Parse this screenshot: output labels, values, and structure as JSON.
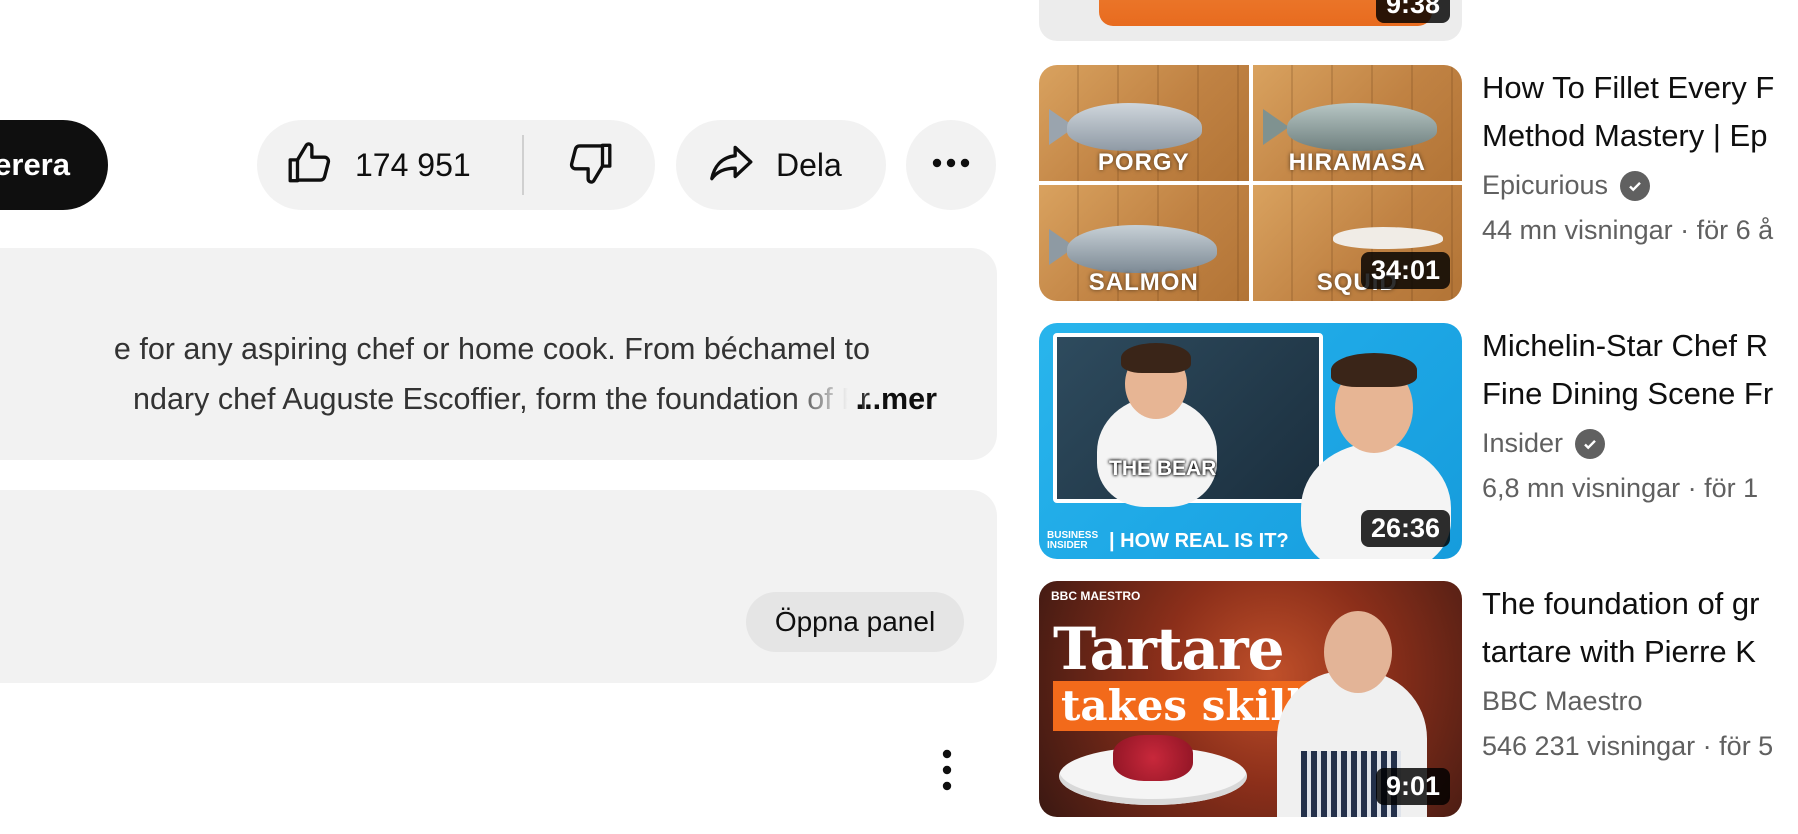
{
  "actions": {
    "subscribe_label": "erera",
    "like_count": "174 951",
    "share_label": "Dela"
  },
  "description": {
    "line1": "e for any aspiring chef or home cook. From béchamel to",
    "line2": "ndary chef Auguste Escoffier, form the foundation of Fr",
    "more_label": "...mer"
  },
  "panel": {
    "open_label": "Öppna panel"
  },
  "recommendations": [
    {
      "duration": "9:38"
    },
    {
      "title_line1": "How To Fillet Every F",
      "title_line2": "Method Mastery | Ep",
      "channel": "Epicurious",
      "verified": true,
      "views": "44 mn visningar",
      "age": "för 6 å",
      "duration": "34:01",
      "thumb_labels": [
        "PORGY",
        "HIRAMASA",
        "SALMON",
        "SQUID"
      ]
    },
    {
      "title_line1": "Michelin-Star Chef R",
      "title_line2": "Fine Dining Scene Fr",
      "channel": "Insider",
      "verified": true,
      "views": "6,8 mn visningar",
      "age": "för 1",
      "duration": "26:36",
      "thumb_tag": "THE BEAR",
      "thumb_strip": "| HOW REAL IS IT?",
      "thumb_logo": "BUSINESS INSIDER"
    },
    {
      "title_line1": "The foundation of gr",
      "title_line2": "tartare with Pierre K",
      "channel": "BBC Maestro",
      "verified": false,
      "views": "546 231 visningar",
      "age": "för 5",
      "duration": "9:01",
      "thumb_word": "Tartare",
      "thumb_banner": "takes skill",
      "thumb_logo": "BBC MAESTRO"
    }
  ],
  "icons": [
    "thumbs-up-icon",
    "thumbs-down-icon",
    "share-arrow-icon",
    "more-horizontal-icon",
    "more-vertical-icon",
    "verified-check-icon"
  ],
  "colors": {
    "pill_background": "#f2f2f2",
    "subscribe_background": "#0f0f0f",
    "secondary_text": "#606060",
    "duration_badge": "#000000"
  }
}
